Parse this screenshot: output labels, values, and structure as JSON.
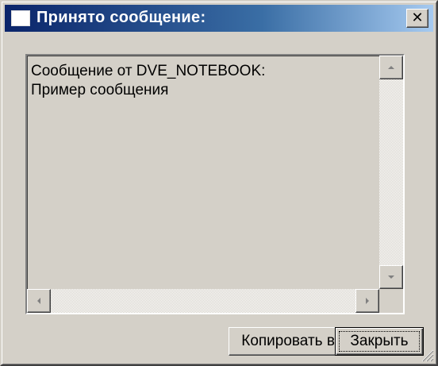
{
  "window": {
    "title": "Принято сообщение:",
    "close_glyph": "✕",
    "icon": "window-icon"
  },
  "message": {
    "lines": [
      "Сообщение от DVE_NOTEBOOK:",
      "Пример сообщения"
    ]
  },
  "buttons": {
    "copy_label": "Копировать в буфер",
    "close_label": "Закрыть"
  },
  "colors": {
    "title_start": "#0a246a",
    "title_end": "#a6caf0",
    "face": "#d4d0c8"
  }
}
